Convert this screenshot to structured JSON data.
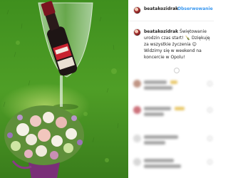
{
  "post": {
    "username": "beatakozidrak",
    "separator": "•",
    "follow_label": "Obserwowanie",
    "caption_user": "beatakozidrak",
    "caption_text": "Świętowanie urodzin czas start! 🍾 Dziękuję za wszystkie życzenia 😊 Widzimy się w weekend na koncercie w Opolu!"
  },
  "icons": {
    "avatar": "profile-avatar-icon",
    "like": "heart-icon",
    "emoji": "smiley-emoji-icon"
  },
  "comments_obscured": true
}
